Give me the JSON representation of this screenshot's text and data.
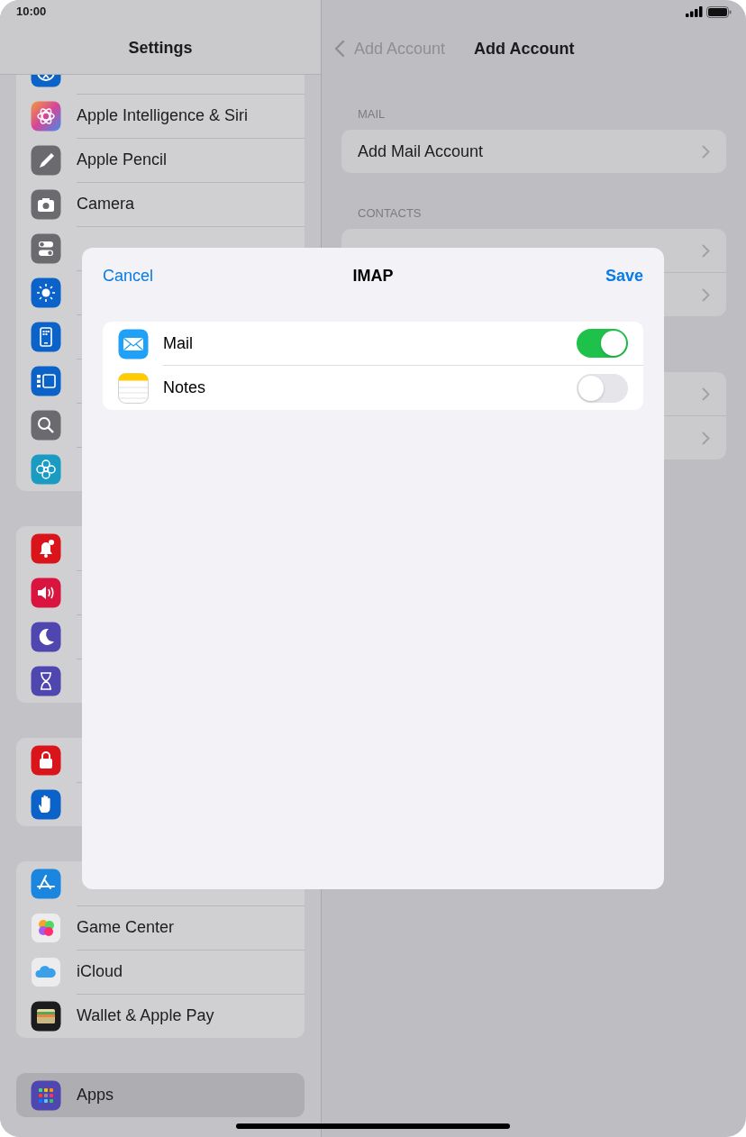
{
  "status_bar": {
    "time": "10:00"
  },
  "sidebar": {
    "title": "Settings",
    "groups": [
      {
        "items": [
          {
            "kind": "accessibility",
            "selected": false
          },
          {
            "kind": "siri",
            "label": "Apple Intelligence & Siri",
            "selected": false
          },
          {
            "kind": "pencil",
            "label": "Apple Pencil",
            "selected": false
          },
          {
            "kind": "camera",
            "label": "Camera",
            "selected": false
          },
          {
            "kind": "control",
            "selected": false
          },
          {
            "kind": "display",
            "selected": false
          },
          {
            "kind": "home",
            "selected": false
          },
          {
            "kind": "multitasking",
            "selected": false
          },
          {
            "kind": "search",
            "selected": false
          },
          {
            "kind": "wallpaper",
            "selected": false
          }
        ]
      },
      {
        "items": [
          {
            "kind": "notifications",
            "selected": false
          },
          {
            "kind": "sounds",
            "selected": false
          },
          {
            "kind": "focus",
            "selected": false
          },
          {
            "kind": "screentime",
            "selected": false
          }
        ]
      },
      {
        "items": [
          {
            "kind": "passcode",
            "selected": false
          },
          {
            "kind": "privacy",
            "selected": false
          }
        ]
      },
      {
        "items": [
          {
            "kind": "appstore",
            "selected": false
          },
          {
            "kind": "gamecenter",
            "label": "Game Center",
            "selected": false
          },
          {
            "kind": "icloud",
            "label": "iCloud",
            "selected": false
          },
          {
            "kind": "wallet",
            "label": "Wallet & Apple Pay",
            "selected": false
          }
        ]
      },
      {
        "items": [
          {
            "kind": "apps",
            "label": "Apps",
            "selected": true
          }
        ]
      }
    ]
  },
  "detail": {
    "back_label": "Add Account",
    "title": "Add Account",
    "sections": [
      {
        "header": "MAIL",
        "rows": [
          {
            "label": "Add Mail Account",
            "chevron": true
          }
        ]
      },
      {
        "header": "CONTACTS",
        "rows": [
          {
            "chevron": true
          },
          {
            "chevron": true
          }
        ]
      },
      {
        "rows": [
          {
            "chevron": true
          },
          {
            "chevron": true
          }
        ]
      }
    ]
  },
  "modal": {
    "cancel": "Cancel",
    "title": "IMAP",
    "save": "Save",
    "rows": [
      {
        "kind": "mail",
        "label": "Mail",
        "on": true
      },
      {
        "kind": "notes",
        "label": "Notes",
        "on": false
      }
    ]
  }
}
